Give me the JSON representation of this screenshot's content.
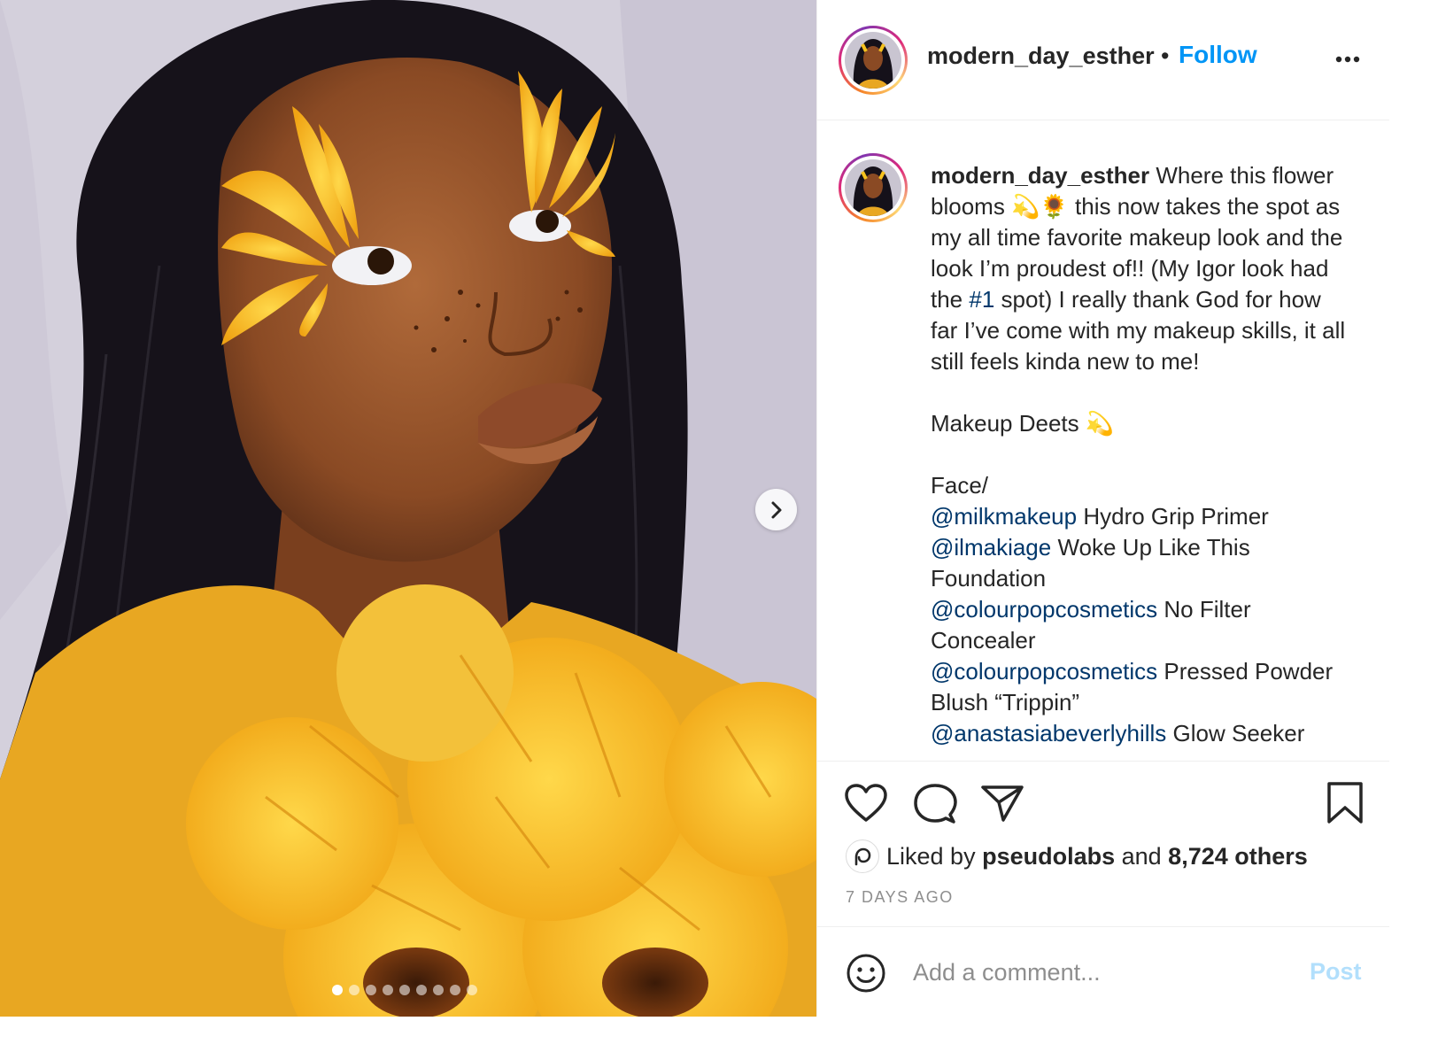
{
  "post": {
    "username": "modern_day_esther",
    "separator": "•",
    "follow_label": "Follow",
    "more_icon": "more-options-icon"
  },
  "caption": {
    "username": "modern_day_esther",
    "intro_1": " Where this flower blooms 💫🌻 this now takes the spot as my all time favorite makeup look and the look I’m proudest of!! (My Igor look had the ",
    "hashtag": "#1",
    "intro_2": " spot) I really thank God for how far I’ve come with my makeup skills, it all still feels kinda new to me!\n\nMakeup Deets 💫\n\nFace/\n",
    "items": [
      {
        "mention": "@milkmakeup",
        "text": " Hydro Grip Primer\n"
      },
      {
        "mention": "@ilmakiage",
        "text": " Woke Up Like This Foundation\n"
      },
      {
        "mention": "@colourpopcosmetics",
        "text": " No Filter Concealer\n"
      },
      {
        "mention": "@colourpopcosmetics",
        "text": " Pressed Powder Blush “Trippin”\n"
      },
      {
        "mention": "@anastasiabeverlyhills",
        "text": " Glow Seeker"
      }
    ]
  },
  "engagement": {
    "liked_by_prefix": "Liked by ",
    "liked_by_user": "pseudolabs",
    "liked_by_mid": " and ",
    "liked_by_count": "8,724 others",
    "time_ago": "7 DAYS AGO"
  },
  "comment": {
    "placeholder": "Add a comment...",
    "post_label": "Post"
  },
  "carousel": {
    "slide_count": 9,
    "active_index": 0
  },
  "colors": {
    "accent": "#0095f6",
    "link": "#00376b",
    "post_disabled": "#b2dffc",
    "muted": "#8e8e8e"
  }
}
